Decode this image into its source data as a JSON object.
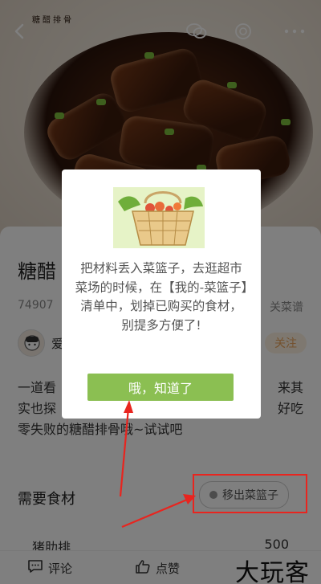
{
  "header": {
    "brand": "糖醋排骨"
  },
  "recipe": {
    "title_prefix": "糖醋",
    "views_prefix": "74907",
    "related_suffix": "关菜谱",
    "author_initial": "爱",
    "follow_suffix": "关注",
    "desc_line1_left": "一道看",
    "desc_line1_right": "来其",
    "desc_line2_left": "实也探",
    "desc_line2_right": "好吃",
    "desc_line3": "零失败的糖醋排骨哦~试试吧"
  },
  "ingredients": {
    "section_title": "需要食材",
    "basket_button": "移出菜篮子",
    "first_item": "猪肋排",
    "first_qty": "500"
  },
  "bottom_bar": {
    "comment_label": "评论",
    "like_label": "点赞"
  },
  "watermark": "大玩客",
  "dialog": {
    "message": "把材料丢入菜篮子，去逛超市菜场的时候，在【我的-菜篮子】清单中，划掉已购买的食材，别提多方便了!",
    "confirm_button": "哦，知道了"
  },
  "colors": {
    "accent_green": "#8bbf52",
    "annotation_red": "#e8251f",
    "follow_orange": "#e8a35a"
  }
}
